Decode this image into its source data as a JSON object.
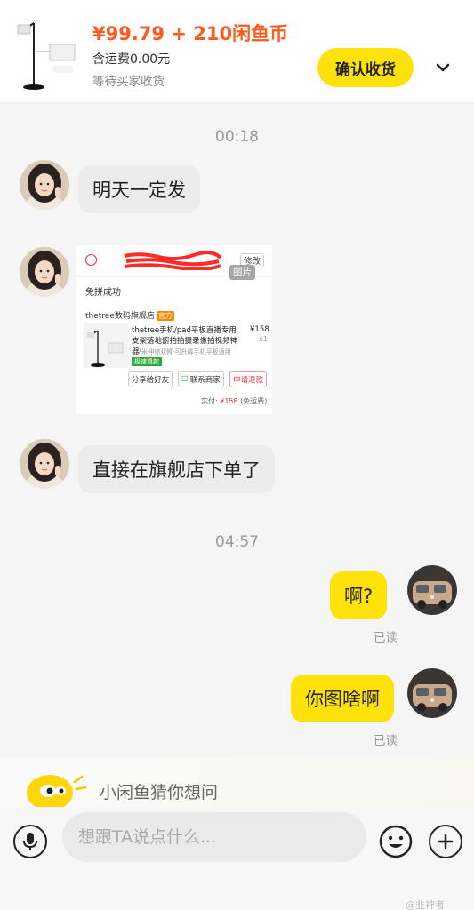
{
  "header": {
    "price": "¥99.79 + 210闲鱼币",
    "shipping": "含运费0.00元",
    "status": "等待买家收货",
    "confirm_button": "确认收货",
    "more_icon": "chevron-down-icon"
  },
  "chat": {
    "time_1": "00:18",
    "msg_1": "明天一定发",
    "image_card": {
      "modify": "修改",
      "image_tag": "图片",
      "pin_success": "免拼成功",
      "store_name": "thetree数码旗舰店",
      "official_badge": "官方",
      "product_title": "thetree手机/pad平板直播专用支架落地俯拍拍摄录像拍视频神器",
      "product_price": "¥158",
      "product_qty": "x1",
      "product_desc": "1.7米伸缩双臂-可升降手机平板通用",
      "fast_refund": "极速退款",
      "share_button": "分享给好友",
      "contact_button": "联系商家",
      "refund_button": "申请退款",
      "paid_label": "实付:",
      "paid_amount": "¥158",
      "paid_note": "(免运费)"
    },
    "msg_2": "直接在旗舰店下单了",
    "time_2": "04:57",
    "msg_3": "啊?",
    "read_1": "已读",
    "msg_4": "你图啥啊",
    "read_2": "已读"
  },
  "suggestion": {
    "text": "小闲鱼猜你想问"
  },
  "input": {
    "placeholder": "想跟TA说点什么...",
    "value": ""
  },
  "watermark": "@韭神者",
  "colors": {
    "accent_yellow": "#ffe20a",
    "price_orange": "#ff5a1f",
    "incoming_bubble": "#ececec"
  }
}
